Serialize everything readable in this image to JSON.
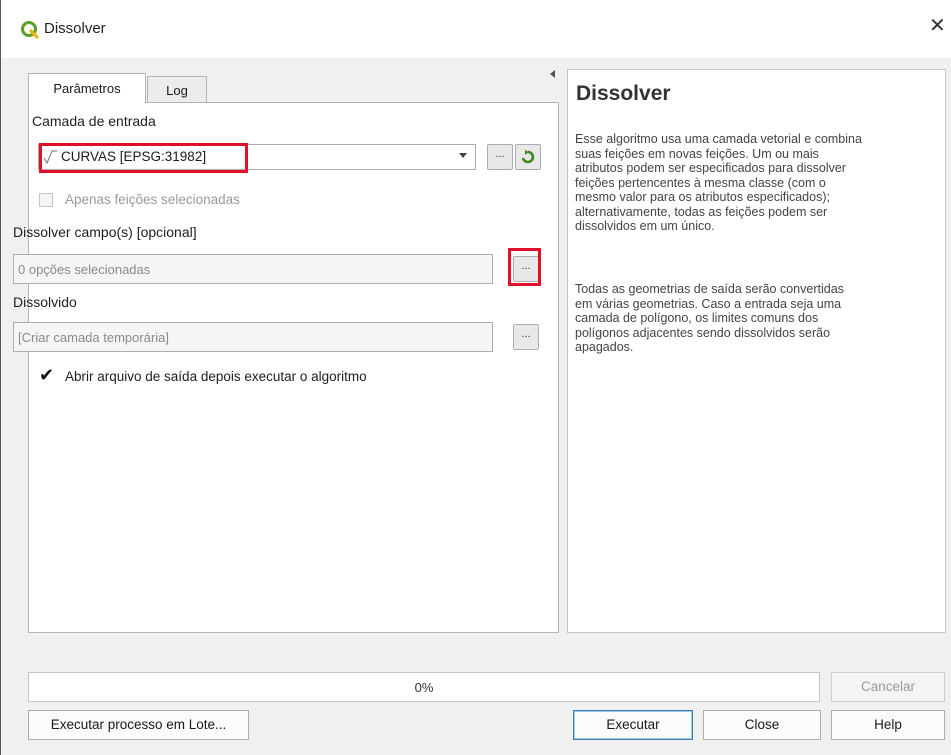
{
  "window": {
    "title": "Dissolver",
    "close_label": "✕"
  },
  "tabs": [
    {
      "label": "Parâmetros",
      "active": true
    },
    {
      "label": "Log",
      "active": false
    }
  ],
  "params": {
    "input_layer_label": "Camada de entrada",
    "input_layer_value": "CURVAS [EPSG:31982]",
    "selected_only_label": "Apenas feições selecionadas",
    "dissolve_fields_label": "Dissolver campo(s) [opcional]",
    "dissolve_fields_value": "0 opções selecionadas",
    "output_label": "Dissolvido",
    "output_placeholder": "[Criar camada temporária]",
    "open_output_label": "Abrir arquivo de saída depois executar o algoritmo",
    "open_output_checked": true,
    "selected_only_checked": false,
    "browse_label": "..."
  },
  "help": {
    "title": "Dissolver",
    "paragraph_1": [
      "Esse algoritmo usa uma camada vetorial e combina",
      "suas feições em novas feições. Um ou mais",
      "atributos podem ser especificados para dissolver",
      "feições pertencentes à mesma classe (com o",
      "mesmo valor para os atributos especificados);",
      "alternativamente, todas as feições podem ser",
      "dissolvidos em um único."
    ],
    "paragraph_2": [
      "Todas as geometrias de saída serão convertidas",
      "em várias geometrias. Caso a entrada seja uma",
      "camada de polígono, os limites comuns dos",
      "polígonos adjacentes sendo dissolvidos serão",
      "apagados."
    ]
  },
  "progress": {
    "value_text": "0%",
    "value": 0
  },
  "buttons": {
    "cancel": "Cancelar",
    "batch": "Executar processo em Lote...",
    "run": "Executar",
    "close": "Close",
    "help": "Help"
  },
  "colors": {
    "highlight": "#e0102a",
    "qgis_green": "#5aa02c"
  },
  "icons": {
    "app": "qgis-logo-icon",
    "layer": "line-layer-icon",
    "iterate": "iterate-icon"
  }
}
